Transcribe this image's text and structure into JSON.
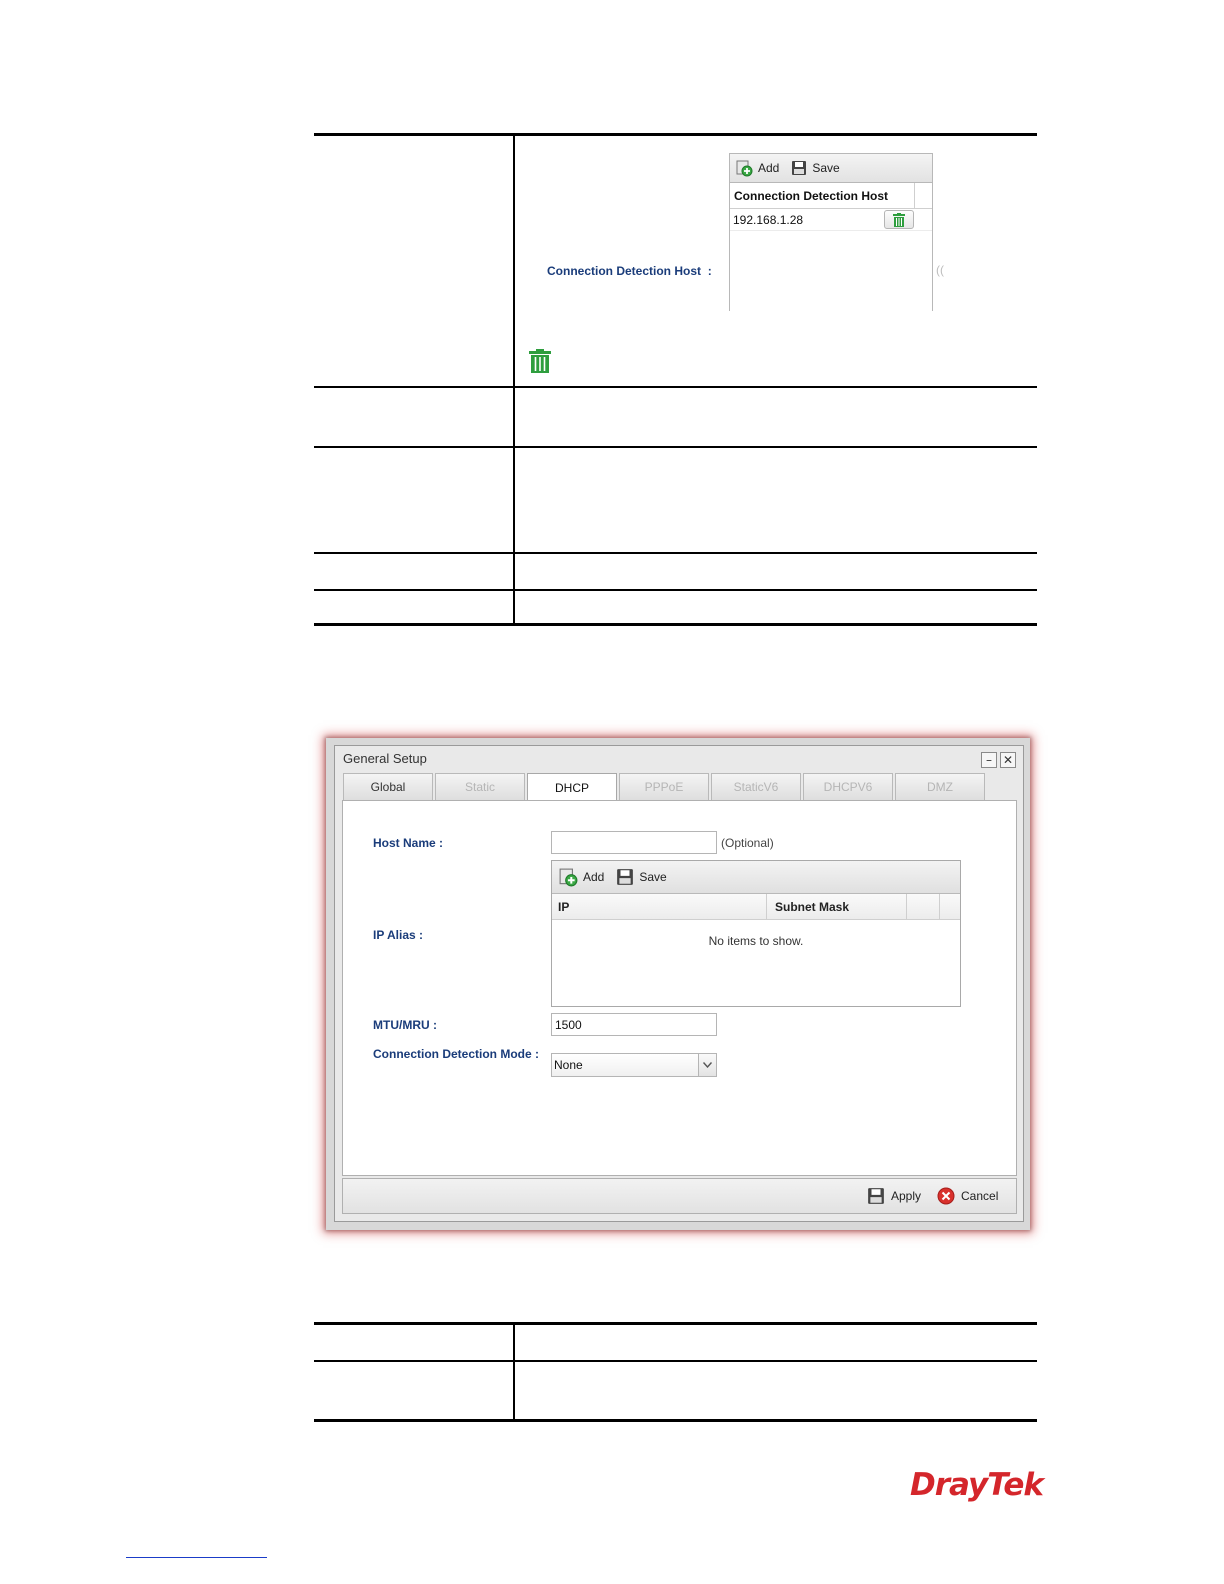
{
  "top_table": {
    "connection_detection_host": {
      "label": "Connection Detection Host",
      "separator": ":",
      "toolbar": {
        "add_label": "Add",
        "save_label": "Save"
      },
      "column_header": "Connection Detection Host",
      "rows": [
        {
          "host": "192.168.1.28"
        }
      ],
      "trailing_text": "(("
    }
  },
  "dialog": {
    "title": "General Setup",
    "window_buttons": {
      "minimize": "–",
      "close": "✕"
    },
    "tabs": [
      {
        "label": "Global",
        "state": "normal"
      },
      {
        "label": "Static",
        "state": "disabled"
      },
      {
        "label": "DHCP",
        "state": "active"
      },
      {
        "label": "PPPoE",
        "state": "disabled"
      },
      {
        "label": "StaticV6",
        "state": "disabled"
      },
      {
        "label": "DHCPV6",
        "state": "disabled"
      },
      {
        "label": "DMZ",
        "state": "disabled"
      }
    ],
    "fields": {
      "host_name": {
        "label": "Host Name :",
        "value": "",
        "note": "(Optional)"
      },
      "ip_alias": {
        "label": "IP Alias :",
        "toolbar": {
          "add_label": "Add",
          "save_label": "Save"
        },
        "columns": [
          "IP",
          "Subnet Mask"
        ],
        "empty_text": "No items to show."
      },
      "mtu_mru": {
        "label": "MTU/MRU :",
        "value": "1500"
      },
      "connection_detection_mode": {
        "label": "Connection Detection Mode :",
        "selected": "None"
      }
    },
    "footer": {
      "apply_label": "Apply",
      "cancel_label": "Cancel"
    }
  },
  "logo": {
    "text": "DrayTek"
  },
  "colors": {
    "label_blue": "#1a3c7a",
    "brand_red": "#d4262b",
    "trash_green": "#2e9e3e",
    "cancel_red": "#d9302c"
  }
}
